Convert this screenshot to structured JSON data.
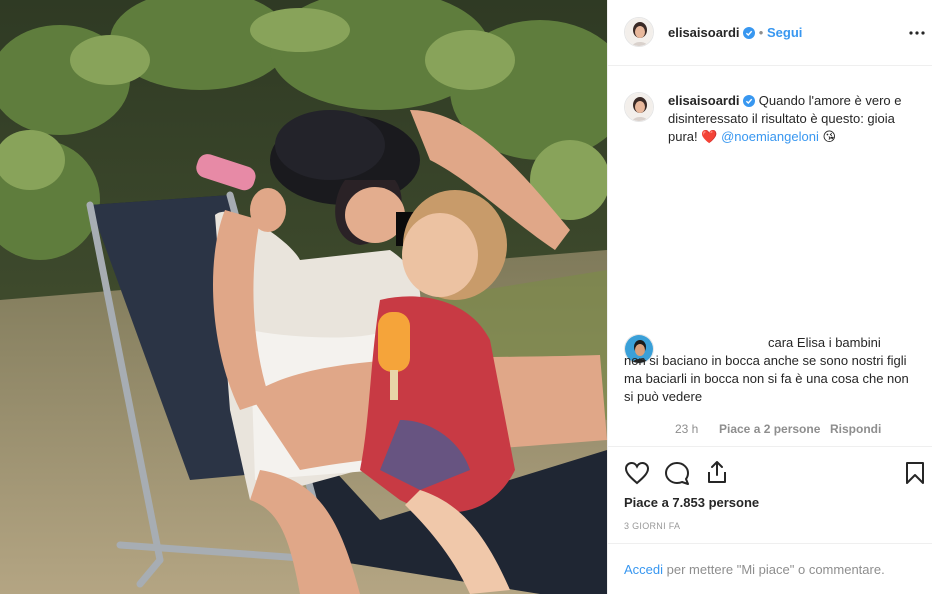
{
  "post": {
    "username": "elisaisoardi",
    "follow_label": "Segui",
    "separator": "•",
    "more_icon": "more-dots-icon",
    "verified_icon": "verified-badge-icon"
  },
  "caption": {
    "username": "elisaisoardi",
    "text": "Quando l'amore è vero e disinteressato il risultato è questo: gioia pura!",
    "heart_emoji": "❤️",
    "mention": "@noemiangeloni",
    "kiss_emoji": "😘"
  },
  "comment": {
    "text_line1": "cara Elisa i bambini",
    "text_rest": "non si baciano in bocca anche se sono nostri figli ma baciarli in bocca non si fa è una cosa che non si può vedere",
    "time": "23 h",
    "likes": "Piace a 2 persone",
    "reply": "Rispondi"
  },
  "actions": {
    "icons": [
      "heart-icon",
      "comment-icon",
      "share-icon",
      "bookmark-icon"
    ],
    "likes_text": "Piace a 7.853 persone",
    "date": "3 GIORNI FA"
  },
  "login": {
    "link": "Accedi",
    "text": "per mettere \"Mi piace\" o commentare."
  },
  "colors": {
    "link_blue": "#3897f0",
    "heart_red": "#ed4956",
    "text": "#262626",
    "muted": "#8e8e8e",
    "border": "#efefef"
  }
}
